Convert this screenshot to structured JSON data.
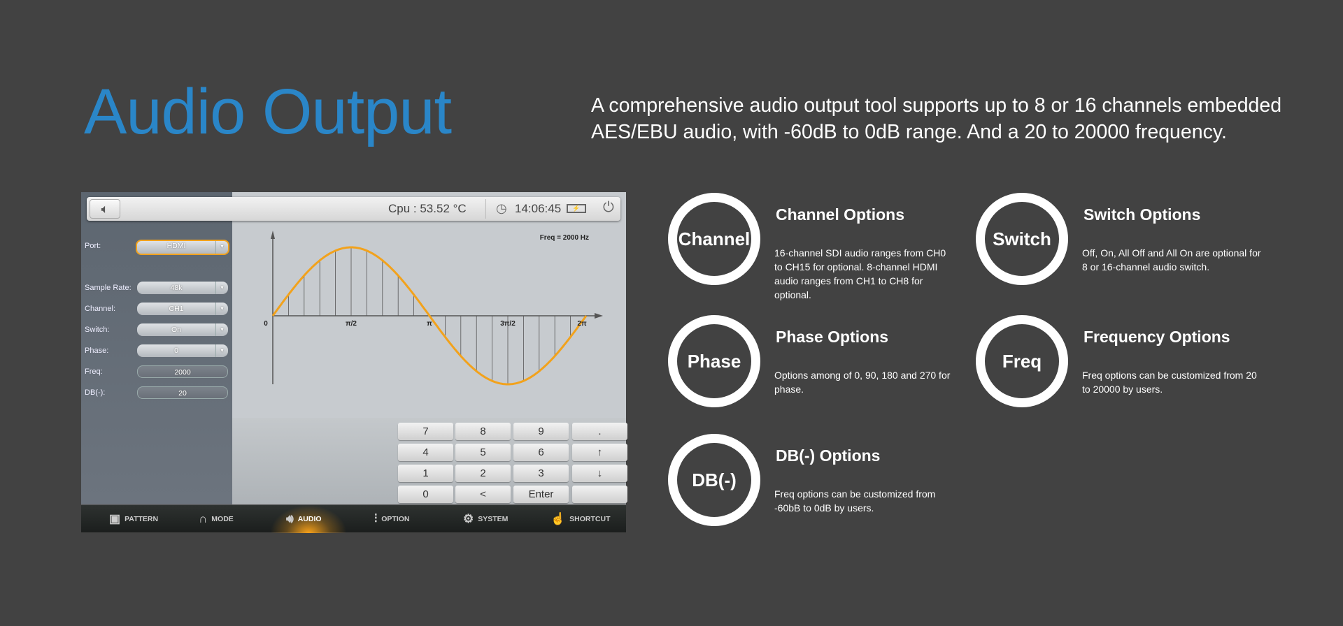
{
  "heading": {
    "title": "Audio Output",
    "description": "A comprehensive audio output tool supports up to 8 or 16 channels embedded AES/EBU audio, with -60dB to 0dB range. And a 20 to 20000 frequency."
  },
  "device": {
    "topbar": {
      "cpu": "Cpu : 53.52 °C",
      "time": "14:06:45"
    },
    "fields": [
      {
        "label": "Port:",
        "value": "HDMI",
        "type": "select",
        "active": true
      },
      {
        "label": "Sample Rate:",
        "value": "48k",
        "type": "select"
      },
      {
        "label": "Channel:",
        "value": "CH1",
        "type": "select"
      },
      {
        "label": "Switch:",
        "value": "On",
        "type": "select"
      },
      {
        "label": "Phase:",
        "value": "0",
        "type": "select"
      },
      {
        "label": "Freq:",
        "value": "2000",
        "type": "input"
      },
      {
        "label": "DB(-):",
        "value": "20",
        "type": "input"
      }
    ],
    "chart": {
      "annotation": "Freq = 2000 Hz",
      "ticks": [
        "0",
        "π/2",
        "π",
        "3π/2",
        "2π"
      ],
      "wave_color": "#f2a21c"
    },
    "keypad": [
      [
        "7",
        "8",
        "9",
        "."
      ],
      [
        "4",
        "5",
        "6",
        "↑"
      ],
      [
        "1",
        "2",
        "3",
        "↓"
      ],
      [
        "0",
        "<",
        "Enter",
        ""
      ]
    ],
    "nav": [
      {
        "label": "PATTERN",
        "icon": "pattern-icon",
        "glyph": "▣"
      },
      {
        "label": "MODE",
        "icon": "mode-icon",
        "glyph": "∩"
      },
      {
        "label": "AUDIO",
        "icon": "speaker-icon",
        "glyph": "🔊︎",
        "active": true
      },
      {
        "label": "OPTION",
        "icon": "sliders-icon",
        "glyph": "⫶"
      },
      {
        "label": "SYSTEM",
        "icon": "gear-icon",
        "glyph": "⚙"
      },
      {
        "label": "SHORTCUT",
        "icon": "shortcut-icon",
        "glyph": "☝"
      }
    ]
  },
  "features": [
    {
      "badge": "Channel",
      "title": "Channel Options",
      "body": "16-channel SDI audio ranges from CH0 to CH15 for optional. 8-channel HDMI audio ranges from CH1 to CH8 for optional."
    },
    {
      "badge": "Switch",
      "title": "Switch Options",
      "body": "Off, On, All Off and All On are optional for 8 or 16-channel audio switch."
    },
    {
      "badge": "Phase",
      "title": "Phase Options",
      "body": "Options among of 0, 90, 180 and 270 for phase."
    },
    {
      "badge": "Freq",
      "title": "Frequency Options",
      "body": "Freq options can be customized from 20 to 20000 by users."
    },
    {
      "badge": "DB(-)",
      "title": "DB(-) Options",
      "body": "Freq options can be customized from -60bB to 0dB by users."
    }
  ]
}
